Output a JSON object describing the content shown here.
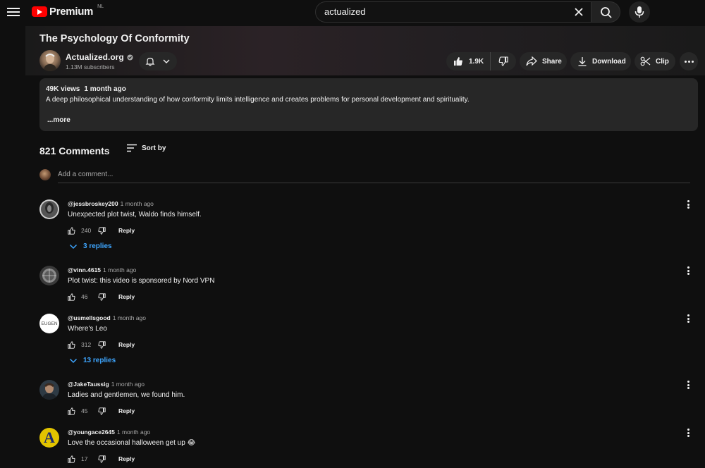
{
  "header": {
    "logo_text": "Premium",
    "region": "NL",
    "search_value": "actualized"
  },
  "video": {
    "title": "The Psychology Of Conformity",
    "channel": "Actualized.org",
    "subscribers": "1.13M subscribers",
    "likes": "1.9K",
    "share_label": "Share",
    "download_label": "Download",
    "clip_label": "Clip"
  },
  "description": {
    "views": "49K views",
    "age": "1 month ago",
    "text": "A deep philosophical understanding of how conformity limits intelligence and creates problems for personal development and spirituality.",
    "more_label": "...more"
  },
  "comments_section": {
    "count_label": "821 Comments",
    "sort_label": "Sort by",
    "add_placeholder": "Add a comment...",
    "items": [
      {
        "author": "@jessbroskey200",
        "time": "1 month ago",
        "text": "Unexpected plot twist, Waldo finds himself.",
        "likes": "240",
        "reply_label": "Reply",
        "replies_label": "3 replies"
      },
      {
        "author": "@vinn.4615",
        "time": "1 month ago",
        "text": "Plot twist: this video is sponsored by Nord VPN",
        "likes": "46",
        "reply_label": "Reply"
      },
      {
        "author": "@usmellsgood",
        "time": "1 month ago",
        "text": "Where's Leo",
        "likes": "312",
        "reply_label": "Reply",
        "replies_label": "13 replies",
        "avatar_text": "EUGEN"
      },
      {
        "author": "@JakeTaussig",
        "time": "1 month ago",
        "text": "Ladies and gentlemen, we found him.",
        "likes": "45",
        "reply_label": "Reply"
      },
      {
        "author": "@youngace2645",
        "time": "1 month ago",
        "text": "Love the occasional halloween get up 😂",
        "likes": "17",
        "reply_label": "Reply",
        "avatar_text": "A"
      }
    ]
  },
  "colors": {
    "background": "#0f0f0f",
    "accent_red": "#ff0000",
    "link_blue": "#3ea6ff",
    "pill_bg": "#272727"
  }
}
